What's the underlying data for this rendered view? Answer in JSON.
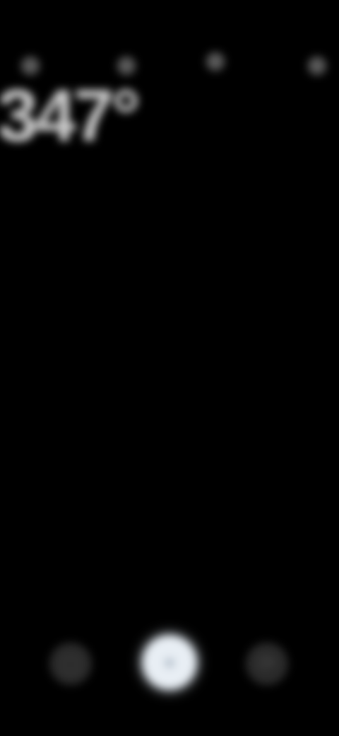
{
  "status_bar": {
    "left_text": "",
    "right_text": ""
  },
  "readouts": {
    "left_value": "347°",
    "left_sub": "",
    "right_value": "",
    "right_sub": ""
  },
  "info": {
    "left_text": "",
    "right_line1": "",
    "right_line2": ""
  },
  "modes": {
    "active_label": "",
    "other_label": ""
  },
  "icons": {
    "top_left_1": "dot-icon",
    "top_left_2": "dot-icon",
    "top_right_1": "dot-icon",
    "top_right_2": "dot-icon",
    "control_left": "gallery-icon",
    "control_center": "shutter-icon",
    "control_right": "switch-camera-icon"
  },
  "colors": {
    "background": "#000000",
    "accent": "#6a5318",
    "shutter": "#e8eef4"
  }
}
